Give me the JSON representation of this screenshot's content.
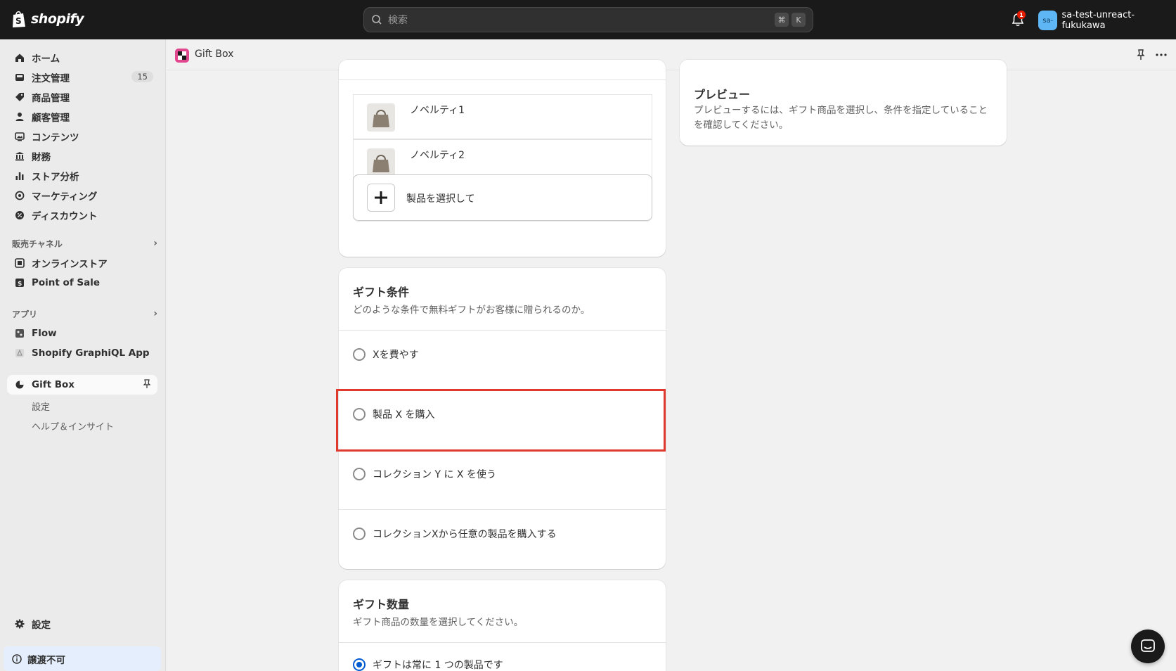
{
  "topbar": {
    "brand": "shopify",
    "search_placeholder": "検索",
    "shortcut_keys": [
      "⌘",
      "K"
    ],
    "notification_count": "1",
    "user_initials": "sa-",
    "user_name": "sa-test-unreact-fukukawa"
  },
  "sidebar": {
    "main_items": [
      {
        "label": "ホーム",
        "icon": "home-icon"
      },
      {
        "label": "注文管理",
        "icon": "inbox-icon",
        "count": "15"
      },
      {
        "label": "商品管理",
        "icon": "tag-icon"
      },
      {
        "label": "顧客管理",
        "icon": "person-icon"
      },
      {
        "label": "コンテンツ",
        "icon": "image-icon"
      },
      {
        "label": "財務",
        "icon": "bank-icon"
      },
      {
        "label": "ストア分析",
        "icon": "bar-chart-icon"
      },
      {
        "label": "マーケティング",
        "icon": "target-icon"
      },
      {
        "label": "ディスカウント",
        "icon": "discount-icon"
      }
    ],
    "sales_channels_label": "販売チャネル",
    "sales_channels": [
      {
        "label": "オンラインストア",
        "icon": "store-icon"
      },
      {
        "label": "Point of Sale",
        "icon": "pos-icon"
      }
    ],
    "apps_label": "アプリ",
    "apps": [
      {
        "label": "Flow",
        "icon": "flow-icon"
      },
      {
        "label": "Shopify GraphiQL App",
        "icon": "graphiql-icon"
      }
    ],
    "active_app": "Gift Box",
    "active_app_subitems": [
      "設定",
      "ヘルプ＆インサイト"
    ],
    "settings_label": "設定",
    "footer_warning": "譲渡不可"
  },
  "appbar": {
    "title": "Gift Box"
  },
  "products_card": {
    "products": [
      "ノベルティ1",
      "ノベルティ2"
    ],
    "select_button_label": "製品を選択して"
  },
  "gift_conditions": {
    "title": "ギフト条件",
    "subtitle": "どのような条件で無料ギフトがお客様に贈られるのか。",
    "options": [
      "Xを費やす",
      "製品 X を購入",
      "コレクション Y に X を使う",
      "コレクションXから任意の製品を購入する"
    ]
  },
  "gift_quantity": {
    "title": "ギフト数量",
    "subtitle": "ギフト商品の数量を選択してください。",
    "option_selected": "ギフトは常に 1 つの製品です"
  },
  "preview": {
    "title": "プレビュー",
    "text": "プレビューするには、ギフト商品を選択し、条件を指定していることを確認してください。"
  },
  "colors": {
    "topbar": "#1a1a1a",
    "highlight": "#e03a2f",
    "radio_selected": "#005bd3"
  }
}
